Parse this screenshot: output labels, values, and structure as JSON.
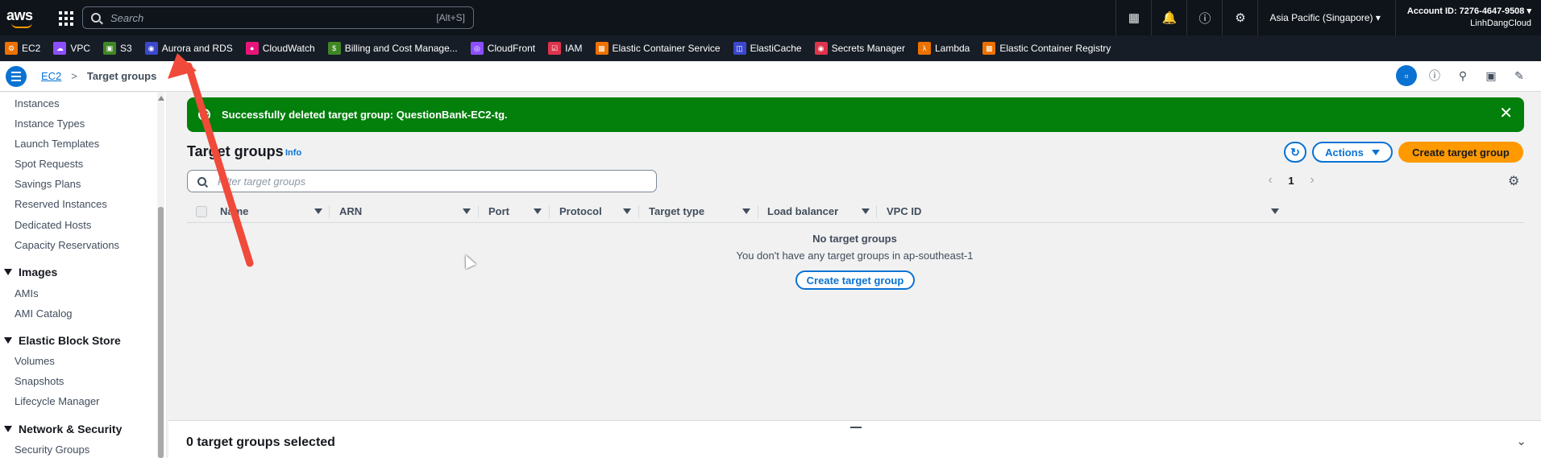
{
  "topnav": {
    "logo": "aws",
    "search_placeholder": "Search",
    "search_shortcut": "[Alt+S]",
    "icons": [
      "cloudshell-icon",
      "notifications-icon",
      "help-icon",
      "settings-icon"
    ],
    "region": "Asia Pacific (Singapore) ▾",
    "account_id": "Account ID: 7276-4647-9508 ▾",
    "account_name": "LinhDangCloud"
  },
  "favorites": [
    {
      "label": "EC2",
      "color": "#ed7100"
    },
    {
      "label": "VPC",
      "color": "#8c4fff"
    },
    {
      "label": "S3",
      "color": "#3f8624"
    },
    {
      "label": "Aurora and RDS",
      "color": "#3b48cc"
    },
    {
      "label": "CloudWatch",
      "color": "#e7157b"
    },
    {
      "label": "Billing and Cost Manage...",
      "color": "#3f8624"
    },
    {
      "label": "CloudFront",
      "color": "#8c4fff"
    },
    {
      "label": "IAM",
      "color": "#dd344c"
    },
    {
      "label": "Elastic Container Service",
      "color": "#ed7100"
    },
    {
      "label": "ElastiCache",
      "color": "#3b48cc"
    },
    {
      "label": "Secrets Manager",
      "color": "#dd344c"
    },
    {
      "label": "Lambda",
      "color": "#ed7100"
    },
    {
      "label": "Elastic Container Registry",
      "color": "#ed7100"
    }
  ],
  "breadcrumb": {
    "root": "EC2",
    "separator": ">",
    "current": "Target groups"
  },
  "sidebar": {
    "items": [
      {
        "type": "item",
        "label": "Instances"
      },
      {
        "type": "item",
        "label": "Instance Types"
      },
      {
        "type": "item",
        "label": "Launch Templates"
      },
      {
        "type": "item",
        "label": "Spot Requests"
      },
      {
        "type": "item",
        "label": "Savings Plans"
      },
      {
        "type": "item",
        "label": "Reserved Instances"
      },
      {
        "type": "item",
        "label": "Dedicated Hosts"
      },
      {
        "type": "item",
        "label": "Capacity Reservations"
      },
      {
        "type": "head",
        "label": "Images"
      },
      {
        "type": "item",
        "label": "AMIs"
      },
      {
        "type": "item",
        "label": "AMI Catalog"
      },
      {
        "type": "head",
        "label": "Elastic Block Store"
      },
      {
        "type": "item",
        "label": "Volumes"
      },
      {
        "type": "item",
        "label": "Snapshots"
      },
      {
        "type": "item",
        "label": "Lifecycle Manager"
      },
      {
        "type": "head",
        "label": "Network & Security"
      },
      {
        "type": "item",
        "label": "Security Groups"
      }
    ]
  },
  "flash": {
    "message": "Successfully deleted target group: QuestionBank-EC2-tg.",
    "close": "✕",
    "color": "#037f0c"
  },
  "main": {
    "title": "Target groups",
    "info": "Info",
    "actions_label": "Actions",
    "create_label": "Create target group",
    "filter_placeholder": "Filter target groups",
    "page": "1",
    "columns": [
      "Name",
      "ARN",
      "Port",
      "Protocol",
      "Target type",
      "Load balancer",
      "VPC ID"
    ],
    "empty_title": "No target groups",
    "empty_desc": "You don't have any target groups in ap-southeast-1",
    "empty_create_label": "Create target group",
    "selected_text": "0 target groups selected"
  },
  "colors": {
    "accent": "#0972d3",
    "primary_button": "#ff9900",
    "annotation_arrow": "#f04a3a"
  }
}
